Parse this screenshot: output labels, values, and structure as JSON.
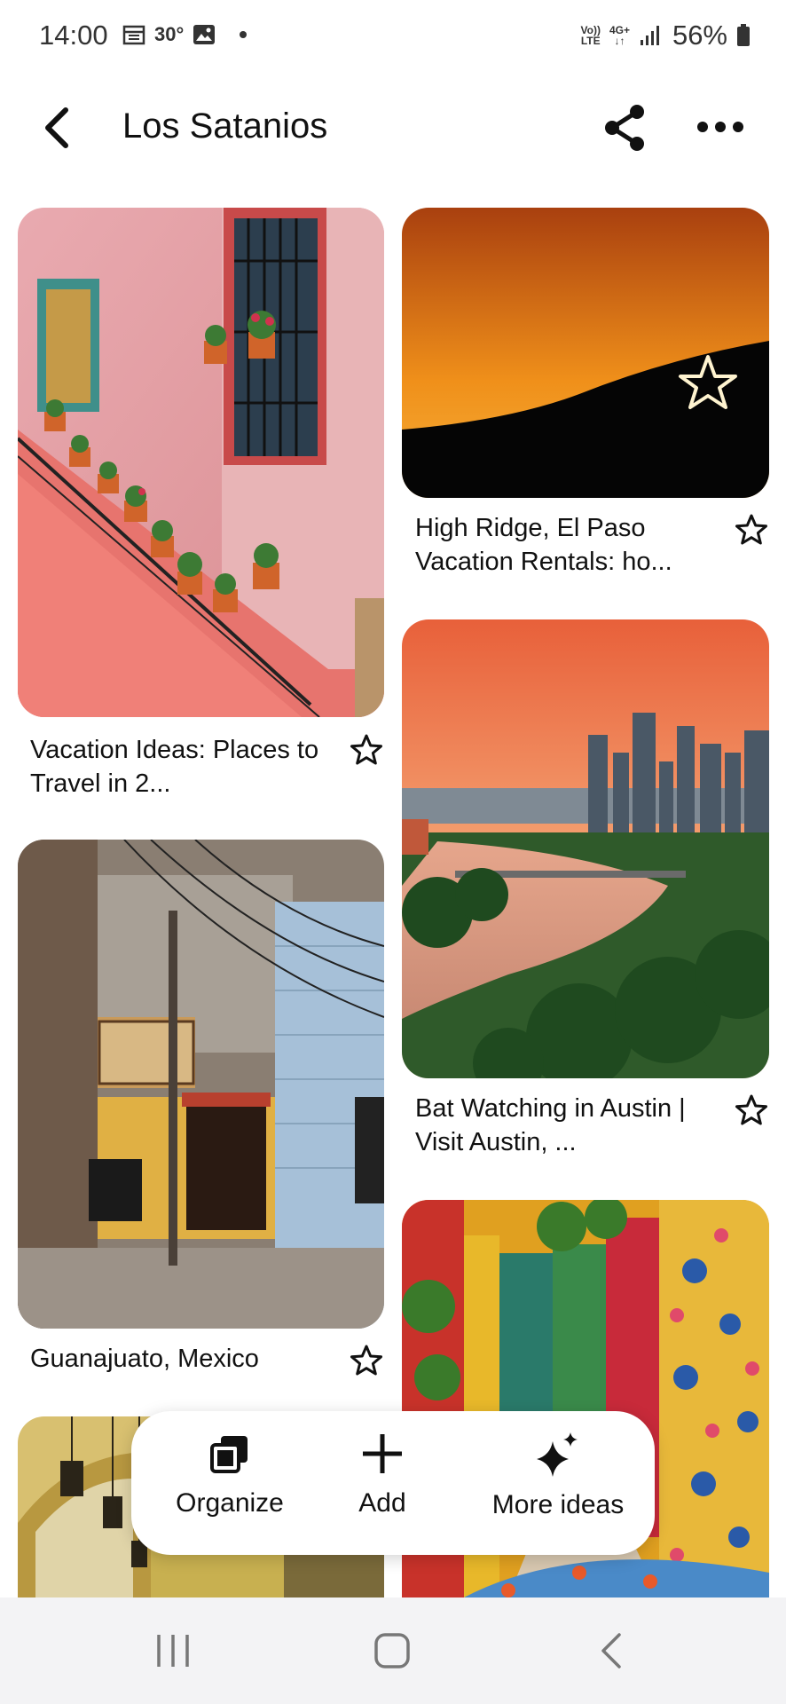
{
  "status": {
    "time": "14:00",
    "temperature": "30°",
    "net_top": "Vo))",
    "net_bottom": "LTE",
    "net2_top": "4G+",
    "battery": "56%"
  },
  "header": {
    "title": "Los Satanios"
  },
  "pins": [
    {
      "caption": "Vacation Ideas: Places to Travel in 2..."
    },
    {
      "caption": "High Ridge, El Paso Vacation Rentals: ho..."
    },
    {
      "caption": "Bat Watching in Austin | Visit Austin, ..."
    },
    {
      "caption": "Guanajuato, Mexico"
    }
  ],
  "actions": {
    "organize": "Organize",
    "add": "Add",
    "more_ideas": "More ideas"
  },
  "icons": {
    "back": "chevron-left-icon",
    "share": "share-icon",
    "more": "more-horizontal-icon",
    "star": "star-outline-icon",
    "organize": "organize-icon",
    "add": "plus-icon",
    "more_ideas": "sparkle-icon",
    "nav_recents": "recents-icon",
    "nav_home": "home-icon",
    "nav_back": "back-icon"
  }
}
